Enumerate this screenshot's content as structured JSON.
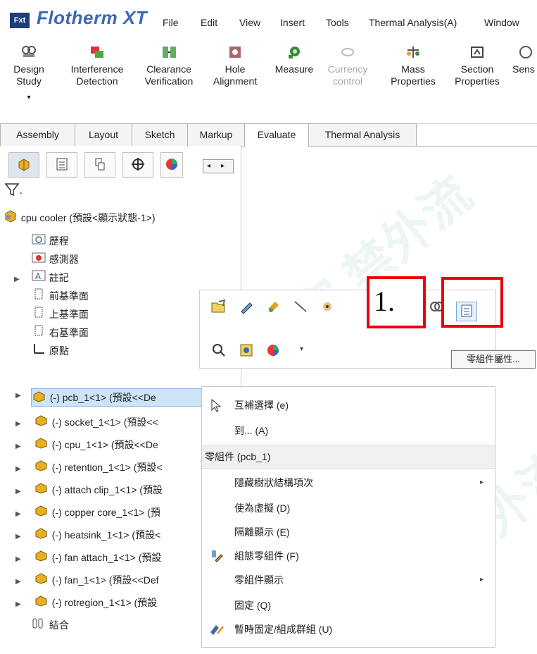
{
  "app": {
    "logo": "Fxt",
    "title": "Flotherm XT"
  },
  "menu": [
    "File",
    "Edit",
    "View",
    "Insert",
    "Tools",
    "Thermal Analysis(A)",
    "Window"
  ],
  "ribbon": {
    "tools": [
      {
        "label1": "Design",
        "label2": "Study",
        "icon": "design-study-icon"
      },
      {
        "label1": "Interference",
        "label2": "Detection",
        "icon": "interference-icon"
      },
      {
        "label1": "Clearance",
        "label2": "Verification",
        "icon": "clearance-icon"
      },
      {
        "label1": "Hole",
        "label2": "Alignment",
        "icon": "hole-alignment-icon"
      },
      {
        "label1": "Measure",
        "label2": "",
        "icon": "measure-icon"
      },
      {
        "label1": "Currency",
        "label2": "control",
        "icon": "currency-icon"
      },
      {
        "label1": "Mass",
        "label2": "Properties",
        "icon": "mass-properties-icon"
      },
      {
        "label1": "Section",
        "label2": "Properties",
        "icon": "section-properties-icon"
      },
      {
        "label1": "Sens",
        "label2": "",
        "icon": "sensor-icon"
      }
    ],
    "dropdown_glyph": "▾"
  },
  "tabs": [
    "Assembly",
    "Layout",
    "Sketch",
    "Markup",
    "Evaluate",
    "Thermal Analysis"
  ],
  "tree": {
    "root": "cpu cooler (預設<顯示狀態-1>)",
    "items": [
      {
        "label": "歷程",
        "icon": "history-folder-icon"
      },
      {
        "label": "感測器",
        "icon": "sensor-folder-icon"
      },
      {
        "label": "註記",
        "icon": "annotation-icon"
      },
      {
        "label": "前基準面",
        "icon": "plane-icon"
      },
      {
        "label": "上基準面",
        "icon": "plane-icon"
      },
      {
        "label": "右基準面",
        "icon": "plane-icon"
      },
      {
        "label": "原點",
        "icon": "origin-icon"
      }
    ],
    "parts": [
      "(-) pcb_1<1> (預設<<De",
      "(-) socket_1<1> (預設<<",
      "(-) cpu_1<1> (預設<<De",
      "(-) retention_1<1> (預設<",
      "(-) attach clip_1<1> (預設",
      "(-) copper core_1<1> (預",
      "(-) heatsink_1<1> (預設<",
      "(-) fan attach_1<1> (預設",
      "(-) fan_1<1> (預設<<Def",
      "(-) rotregion_1<1> (預設"
    ],
    "mates": "結合"
  },
  "annotation": {
    "step_label": "1.",
    "tooltip": "零組件屬性..."
  },
  "context_menu": {
    "items_top": [
      {
        "label": "互補選擇 (e)",
        "icon": "select-cursor-icon"
      },
      {
        "label": "到... (A)",
        "icon": ""
      }
    ],
    "header": "零組件 (pcb_1)",
    "items": [
      {
        "label": "隱藏樹狀結構項次",
        "submenu": true
      },
      {
        "label": "使為虛擬 (D)",
        "submenu": false
      },
      {
        "label": "隔離顯示 (E)",
        "submenu": false
      },
      {
        "label": "組態零組件 (F)",
        "submenu": false
      },
      {
        "label": "零組件顯示",
        "submenu": true
      },
      {
        "label": "固定 (Q)",
        "submenu": false
      },
      {
        "label": "暫時固定/組成群組 (U)",
        "submenu": false
      }
    ],
    "submenu_glyph": "▸"
  },
  "watermark": "機密 禁外流",
  "colors": {
    "annotation_red": "#e8000b",
    "selection": "#cde4f7",
    "part_icon": "#e8b020"
  }
}
